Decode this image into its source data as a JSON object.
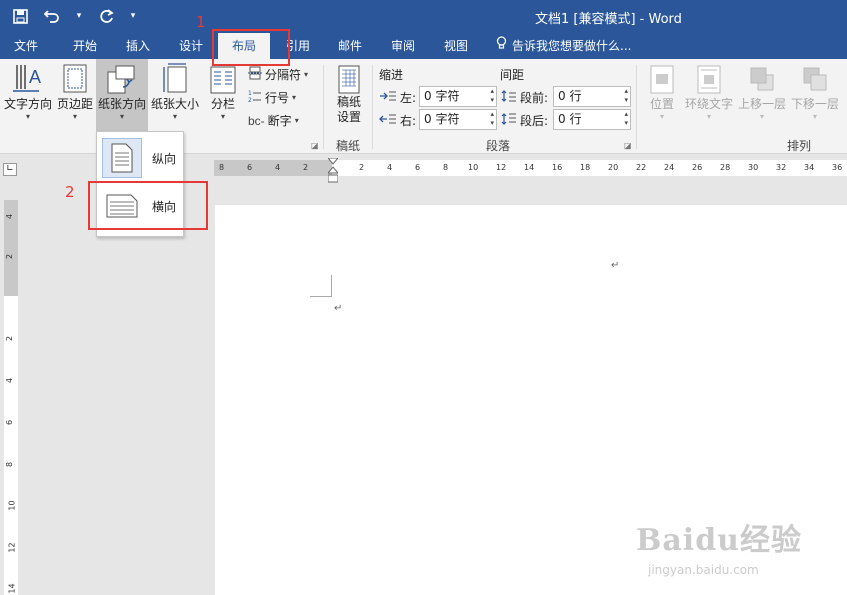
{
  "window": {
    "title": "文档1 [兼容模式] - Word"
  },
  "quick_access": {
    "more": "▾"
  },
  "tabs": [
    {
      "label": "文件"
    },
    {
      "label": "开始"
    },
    {
      "label": "插入"
    },
    {
      "label": "设计"
    },
    {
      "label": "布局",
      "active": true
    },
    {
      "label": "引用"
    },
    {
      "label": "邮件"
    },
    {
      "label": "审阅"
    },
    {
      "label": "视图"
    }
  ],
  "tell_me": "告诉我您想要做什么...",
  "ribbon": {
    "page_setup": {
      "text_direction": "文字方向",
      "margins": "页边距",
      "orientation": "纸张方向",
      "size": "纸张大小",
      "columns": "分栏",
      "breaks": "分隔符",
      "line_numbers": "行号",
      "hyphenation": "断字"
    },
    "manuscript": {
      "button": "稿纸\n设置",
      "group": "稿纸"
    },
    "paragraph": {
      "indent_header": "缩进",
      "spacing_header": "间距",
      "left_label": "左:",
      "right_label": "右:",
      "before_label": "段前:",
      "after_label": "段后:",
      "left_value": "0 字符",
      "right_value": "0 字符",
      "before_value": "0 行",
      "after_value": "0 行",
      "group": "段落"
    },
    "arrange": {
      "position": "位置",
      "wrap_text": "环绕文字",
      "bring_forward": "上移一层",
      "send_backward": "下移一层",
      "group": "排列"
    }
  },
  "ruler": {
    "ticks": [
      "8",
      "6",
      "4",
      "2",
      "2",
      "4",
      "6",
      "8",
      "10",
      "12",
      "14",
      "16",
      "18",
      "20",
      "22",
      "24",
      "26",
      "28",
      "30",
      "32",
      "34",
      "36"
    ],
    "vticks": [
      "4",
      "2",
      "2",
      "4",
      "6",
      "8",
      "10",
      "12",
      "14"
    ]
  },
  "orientation_menu": {
    "portrait": "纵向",
    "landscape": "横向"
  },
  "annotations": {
    "step1": "1",
    "step2": "2"
  },
  "watermark": {
    "brand": "Baidu经验",
    "url": "jingyan.baidu.com"
  },
  "paragraph_mark": "↵"
}
